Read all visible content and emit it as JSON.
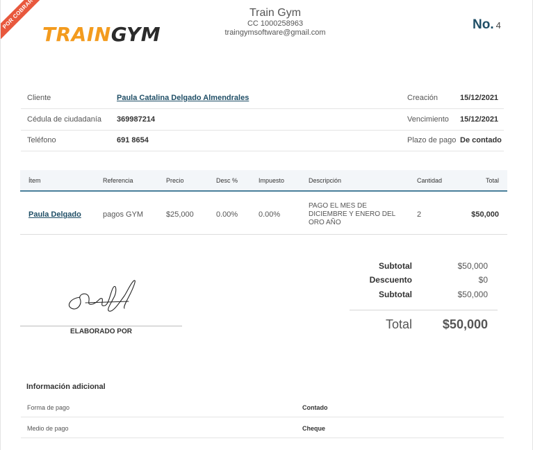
{
  "ribbon": {
    "text": "POR COBRAR"
  },
  "logo": {
    "part1": "TRAIN",
    "part2": "GYM"
  },
  "company": {
    "name": "Train Gym",
    "id": "CC 1000258963",
    "email": "traingymsoftware@gmail.com"
  },
  "invoice": {
    "no_label": "No.",
    "number": "4"
  },
  "client": {
    "rows": [
      {
        "label": "Cliente",
        "value": "Paula Catalina Delgado Almendrales",
        "label2": "Creación",
        "value2": "15/12/2021"
      },
      {
        "label": "Cédula de ciudadanía",
        "value": "369987214",
        "label2": "Vencimiento",
        "value2": "15/12/2021"
      },
      {
        "label": "Teléfono",
        "value": "691 8654",
        "label2": "Plazo de pago",
        "value2": "De contado"
      }
    ]
  },
  "table": {
    "headers": [
      "Ítem",
      "Referencia",
      "Precio",
      "Desc %",
      "Impuesto",
      "Descripción",
      "Cantidad",
      "Total"
    ],
    "rows": [
      {
        "item": "Paula Delgado",
        "reference": "pagos GYM",
        "price": "$25,000",
        "discount": "0.00%",
        "tax": "0.00%",
        "description_lines": [
          "PAGO EL MES DE",
          "DICIEMBRE Y ENERO DEL",
          "ORO AÑO"
        ],
        "quantity": "2",
        "total": "$50,000"
      }
    ]
  },
  "signature": {
    "label": "ELABORADO POR"
  },
  "totals": {
    "rows": [
      {
        "label": "Subtotal",
        "value": "$50,000"
      },
      {
        "label": "Descuento",
        "value": "$0"
      },
      {
        "label": "Subtotal",
        "value": "$50,000"
      }
    ],
    "grand_label": "Total",
    "grand_value": "$50,000"
  },
  "additional": {
    "title": "Información adicional",
    "rows": [
      {
        "label": "Forma de pago",
        "value": "Contado"
      },
      {
        "label": "Medio de pago",
        "value": "Cheque"
      }
    ]
  },
  "colors": {
    "accent": "#1f4e66",
    "ribbon": "#e8583d",
    "logo_orange": "#f39b1e",
    "header_rule": "#4a7f9a"
  }
}
